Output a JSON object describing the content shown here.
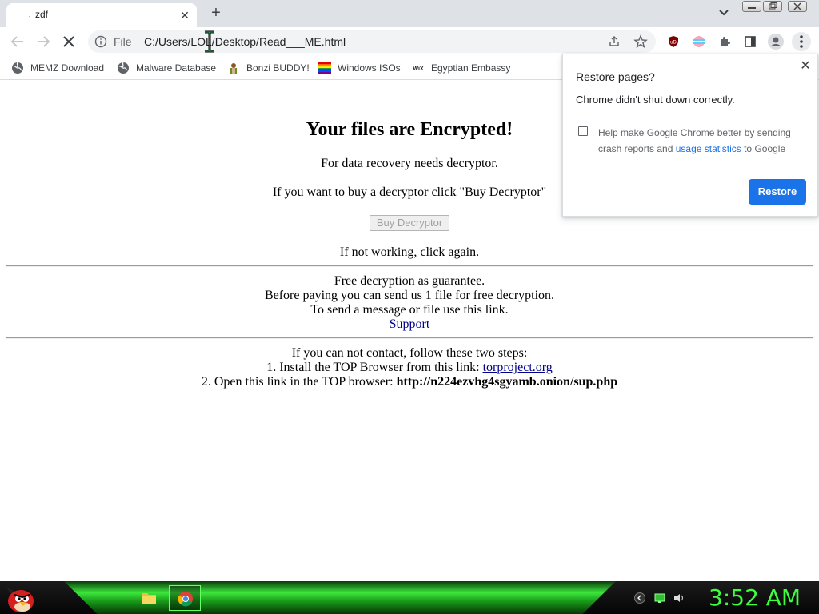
{
  "tab": {
    "title": "zdf"
  },
  "omnibox": {
    "scheme_label": "File",
    "url": "C:/Users/LOL/Desktop/Read___ME.html"
  },
  "bookmarks": [
    {
      "label": "MEMZ Download",
      "icon": "globe-icon"
    },
    {
      "label": "Malware Database",
      "icon": "globe-icon"
    },
    {
      "label": "Bonzi BUDDY!",
      "icon": "bonzi-icon"
    },
    {
      "label": "Windows ISOs",
      "icon": "rainbow-flag-icon"
    },
    {
      "label": "Egyptian Embassy",
      "icon": "wix-icon"
    }
  ],
  "page": {
    "heading": "Your files are Encrypted!",
    "line1": "For data recovery needs decryptor.",
    "line2": "If you want to buy a decryptor click \"Buy Decryptor\"",
    "buy_button": "Buy Decryptor",
    "line3": "If not working, click again.",
    "free1": "Free decryption as guarantee.",
    "free2": "Before paying you can send us 1 file for free decryption.",
    "free3": "To send a message or file use this link.",
    "support_link": "Support",
    "steps_intro": "If you can not contact, follow these two steps:",
    "step1_prefix": "1. Install the TOP Browser from this link: ",
    "step1_link": "torproject.org",
    "step2_prefix": "2. Open this link in the TOP browser: ",
    "step2_url": "http://n224ezvhg4sgyamb.onion/sup.php"
  },
  "popup": {
    "title": "Restore pages?",
    "message": "Chrome didn't shut down correctly.",
    "checkbox_text_before": "Help make Google Chrome better by sending crash reports and ",
    "checkbox_link": "usage statistics",
    "checkbox_text_after": " to Google",
    "checkbox_checked": false,
    "restore_button": "Restore"
  },
  "taskbar": {
    "clock": "3:52 AM"
  },
  "colors": {
    "accent": "#1a73e8",
    "clock": "#3dff3d",
    "link": "#00008b"
  }
}
